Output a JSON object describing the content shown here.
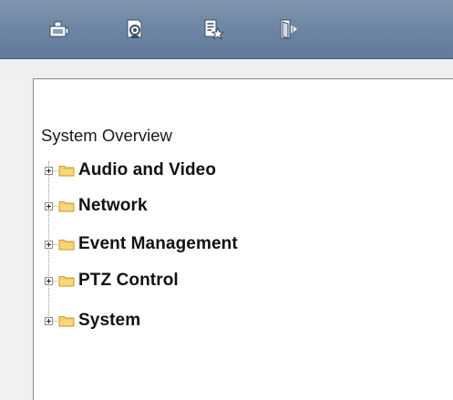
{
  "toolbar": {
    "buttons": [
      {
        "name": "live-view",
        "icon": "camera-icon"
      },
      {
        "name": "playback",
        "icon": "playback-search-icon"
      },
      {
        "name": "log",
        "icon": "log-star-icon"
      },
      {
        "name": "logout",
        "icon": "exit-door-icon"
      }
    ],
    "background_color": "#6e86a3"
  },
  "tree": {
    "root_label": "System Overview",
    "items": [
      {
        "label": "Audio and Video",
        "icon": "folder-icon",
        "expander": "plus-expander-icon"
      },
      {
        "label": "Network",
        "icon": "folder-icon",
        "expander": "plus-expander-icon"
      },
      {
        "label": "Event Management",
        "icon": "folder-icon",
        "expander": "plus-expander-icon"
      },
      {
        "label": "PTZ Control",
        "icon": "folder-icon",
        "expander": "plus-expander-icon"
      },
      {
        "label": "System",
        "icon": "folder-icon",
        "expander": "plus-expander-icon"
      }
    ]
  },
  "colors": {
    "folder_fill": "#f6d77a",
    "folder_stroke": "#c79a2c",
    "panel_bg": "#ffffff"
  }
}
